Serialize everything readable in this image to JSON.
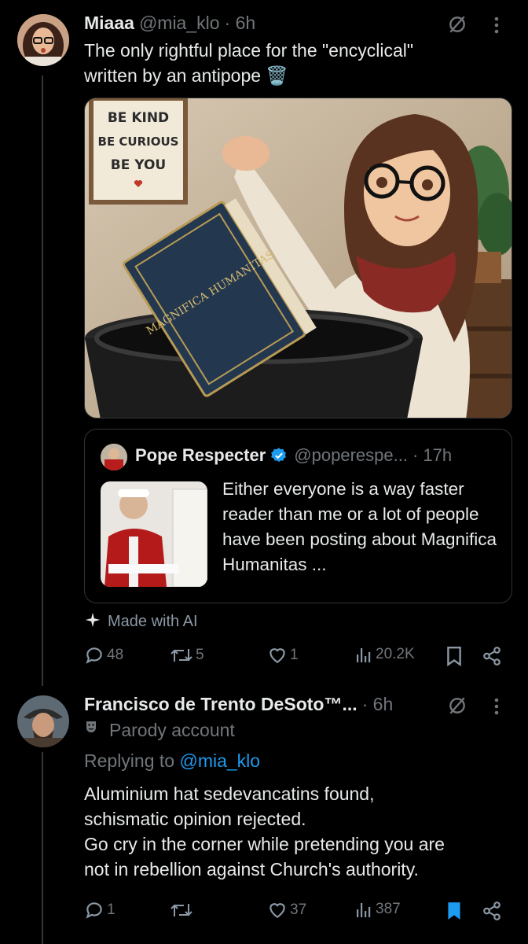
{
  "tweet1": {
    "display_name": "Miaaa",
    "handle": "@mia_klo",
    "time": "· 6h",
    "text_line1": "The only rightful place for the \"encyclical\"",
    "text_line2": "written by an antipope 🗑️",
    "image_book_title": "MAGNIFICA HUMANITAS",
    "image_sign": [
      "BE KIND",
      "BE CURIOUS",
      "BE YOU"
    ],
    "quote": {
      "display_name": "Pope Respecter",
      "handle": "@poperespe...",
      "time": "· 17h",
      "text": "Either everyone is a way faster reader than me or a lot of people have been posting about Magnifica Humanitas ..."
    },
    "ai_label": "Made with AI",
    "actions": {
      "replies": "48",
      "reposts": "5",
      "likes": "1",
      "views": "20.2K"
    }
  },
  "tweet2": {
    "display_name": "Francisco de Trento DeSoto™...",
    "time": "· 6h",
    "parody_label": "Parody account",
    "replying_prefix": "Replying to",
    "replying_handle": "@mia_klo",
    "lines": [
      "Aluminium hat sedevancatins found,",
      "schismatic opinion rejected.",
      "Go cry in the corner while pretending you are",
      "not in rebellion against Church's authority."
    ],
    "actions": {
      "replies": "1",
      "likes": "37",
      "views": "387"
    }
  },
  "colors": {
    "accent": "#1d9bf0",
    "muted": "#71767b",
    "background": "#000000",
    "divider": "#2f3336"
  }
}
